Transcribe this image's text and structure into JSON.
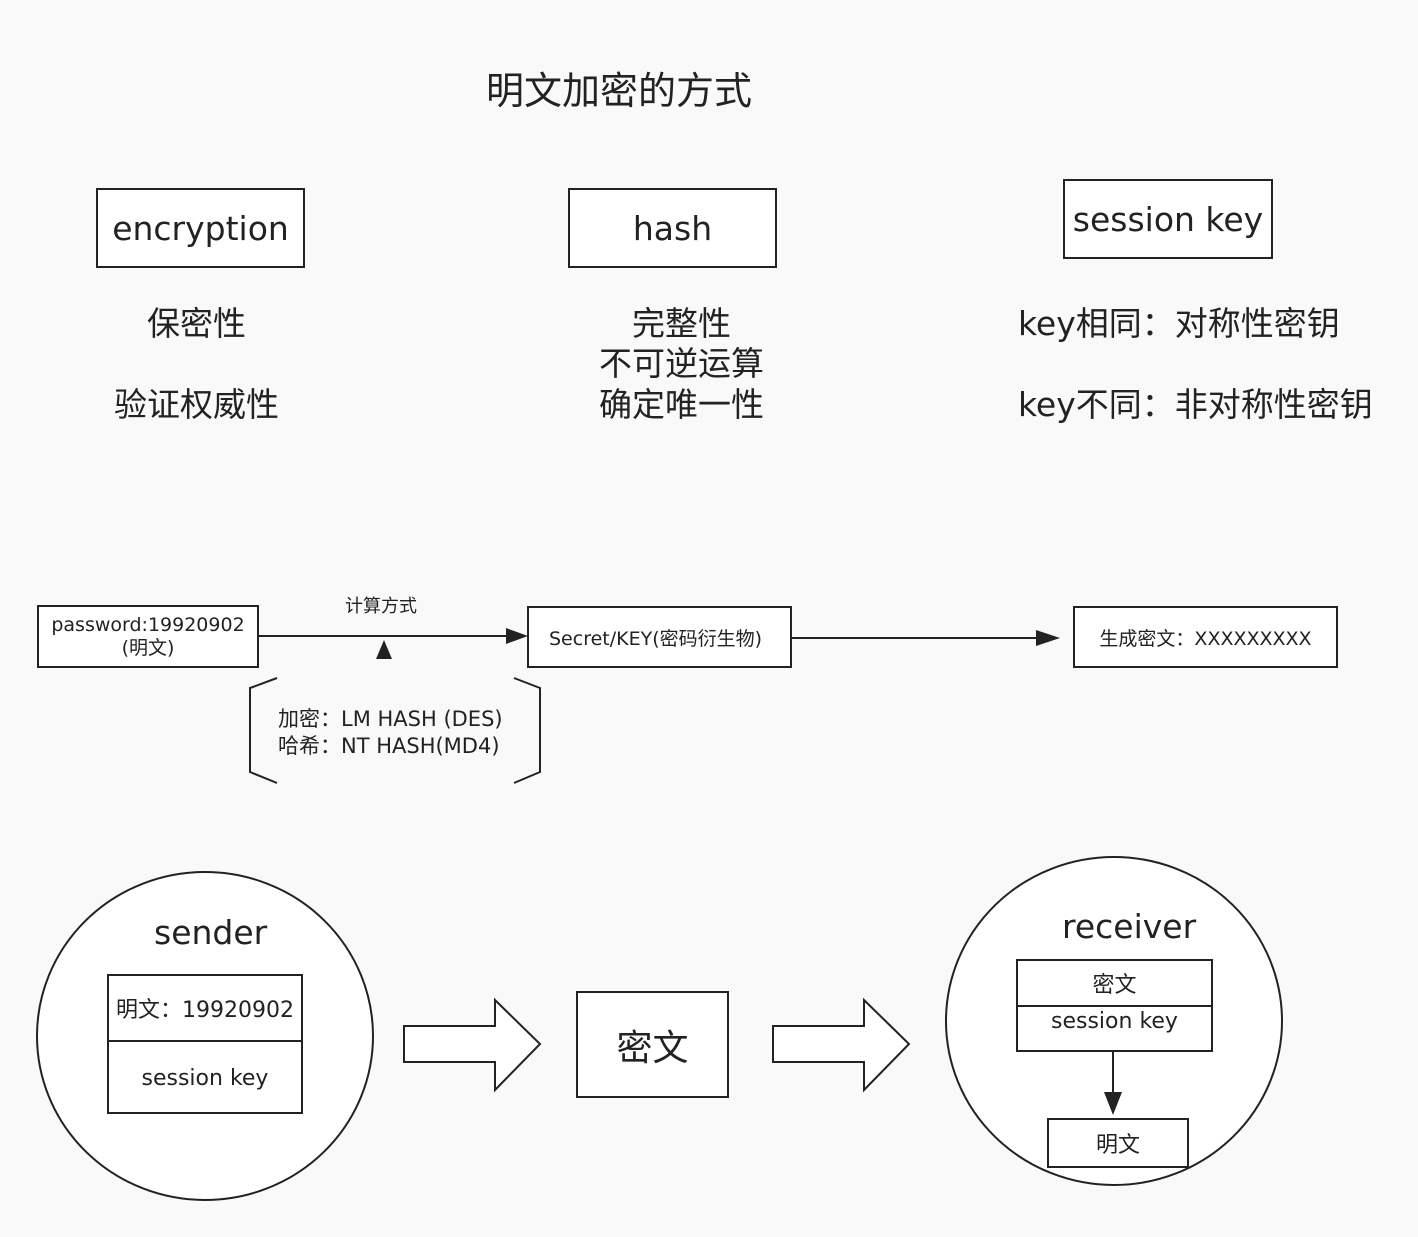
{
  "title": "明文加密的方式",
  "categories": [
    {
      "name": "encryption",
      "lines": [
        "保密性",
        "验证权威性"
      ]
    },
    {
      "name": "hash",
      "lines": [
        "完整性",
        "不可逆运算",
        "确定唯一性"
      ]
    },
    {
      "name": "session key",
      "lines": [
        "key相同：对称性密钥",
        "key不同：非对称性密钥"
      ]
    }
  ],
  "flow": {
    "input_line1": "password:19920902",
    "input_line2": "(明文)",
    "method_label": "计算方式",
    "method_line1": "加密：LM HASH (DES)",
    "method_line2": "哈希：NT HASH(MD4)",
    "secret": "Secret/KEY(密码衍生物)",
    "output": "生成密文：XXXXXXXXX"
  },
  "exchange": {
    "sender": {
      "title": "sender",
      "plaintext": "明文：19920902",
      "key": "session key"
    },
    "ciphertext": "密文",
    "receiver": {
      "title": "receiver",
      "ciphertext": "密文",
      "key": "session key",
      "result": "明文"
    }
  }
}
